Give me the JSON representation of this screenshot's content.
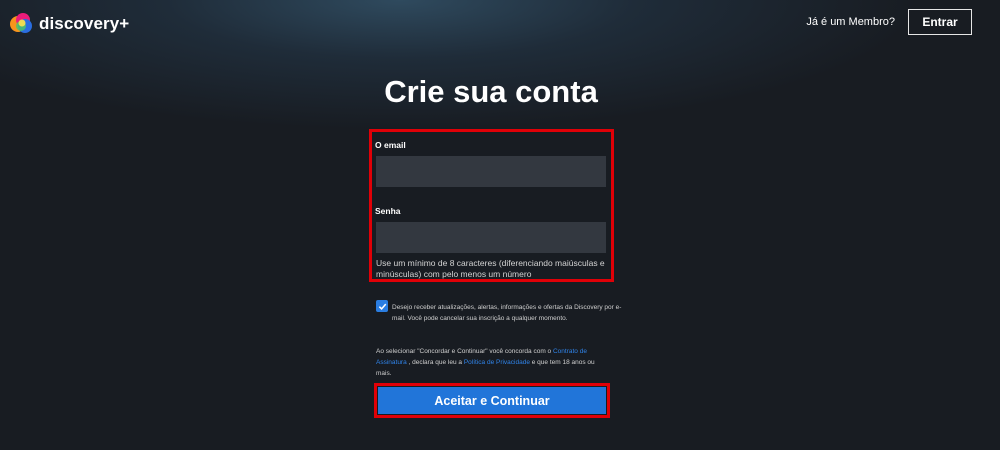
{
  "header": {
    "brand": "discovery+",
    "member_prompt": "Já é um Membro?",
    "signin_label": "Entrar"
  },
  "main": {
    "title": "Crie sua conta",
    "email_label": "O email",
    "email_value": "",
    "password_label": "Senha",
    "password_value": "",
    "password_hint": "Use um mínimo de 8 caracteres (diferenciando maiúsculas e minúsculas) com pelo menos um número",
    "marketing_opt_in": {
      "checked": true,
      "text": "Desejo receber atualizações, alertas, informações e ofertas da Discovery por e-mail. Você pode cancelar sua inscrição a qualquer momento."
    },
    "legal": {
      "part1": "Ao selecionar \"Concordar e Continuar\" você concorda com o ",
      "link1": "Contrato de Assinatura",
      "part2": " , declara que leu a ",
      "link2": "Política de Privacidade",
      "part3": " e que tem 18 anos ou mais."
    },
    "cta_label": "Aceitar e Continuar"
  },
  "colors": {
    "accent": "#2175d9",
    "highlight_border": "#e00007",
    "input_bg": "#333840",
    "link": "#2f83e8"
  }
}
